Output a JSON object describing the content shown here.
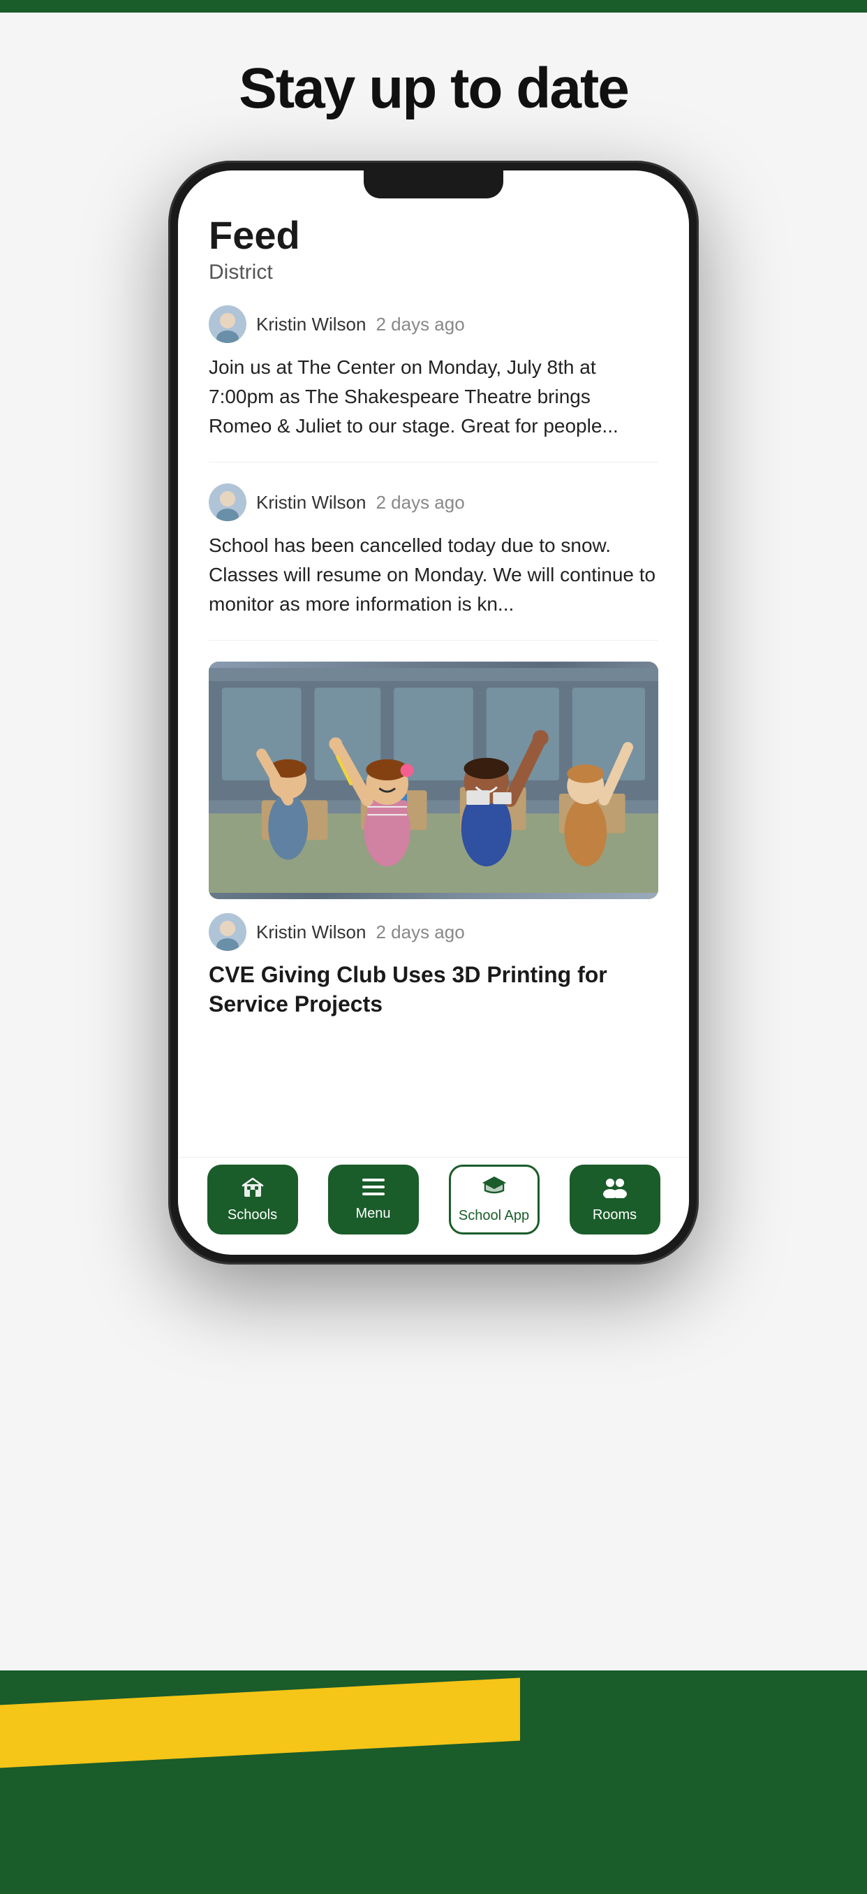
{
  "page": {
    "title": "Stay up to date",
    "background_top_color": "#1a5c2a",
    "background_bottom_color": "#1a5c2a",
    "accent_color": "#f5c518"
  },
  "phone": {
    "screen": {
      "feed": {
        "title": "Feed",
        "subtitle": "District",
        "posts": [
          {
            "id": 1,
            "author": "Kristin Wilson",
            "time": "2 days ago",
            "text": "Join us at The Center on Monday, July 8th at 7:00pm as The Shakespeare Theatre brings Romeo & Juliet to our stage. Great for people...",
            "has_image": false,
            "post_title": null
          },
          {
            "id": 2,
            "author": "Kristin Wilson",
            "time": "2 days ago",
            "text": "School has been cancelled today due to snow. Classes will resume on Monday. We will continue to monitor as more information is kn...",
            "has_image": false,
            "post_title": null
          },
          {
            "id": 3,
            "author": "Kristin Wilson",
            "time": "2 days ago",
            "text": null,
            "has_image": true,
            "post_title": "CVE Giving Club Uses 3D Printing for Service Projects"
          }
        ]
      },
      "bottom_nav": {
        "items": [
          {
            "id": "schools",
            "label": "Schools",
            "icon": "🏫",
            "active": false
          },
          {
            "id": "menu",
            "label": "Menu",
            "icon": "☰",
            "active": false
          },
          {
            "id": "school-app",
            "label": "School App",
            "icon": "📚",
            "active": true
          },
          {
            "id": "rooms",
            "label": "Rooms",
            "icon": "👥",
            "active": false
          }
        ]
      }
    }
  }
}
